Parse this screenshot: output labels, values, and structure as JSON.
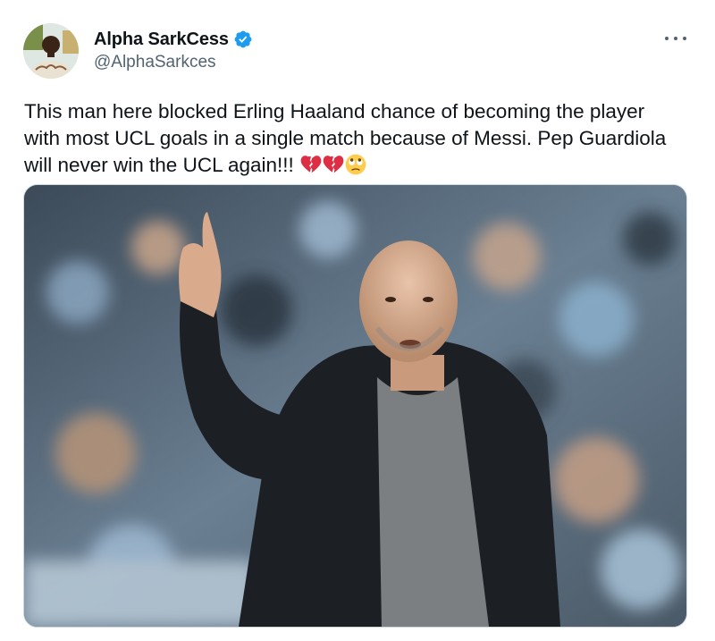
{
  "author": {
    "display_name": "Alpha SarkCess",
    "handle": "@AlphaSarkces",
    "verified": true
  },
  "tweet": {
    "text": "This man here blocked Erling Haaland chance of becoming the player with most UCL goals in a single match because of Messi. Pep Guardiola will never win the UCL again!!!",
    "emojis": [
      "broken-heart",
      "broken-heart",
      "face-with-rolling-eyes"
    ]
  },
  "colors": {
    "text": "#0f1419",
    "secondary": "#536471",
    "verified": "#1d9bf0",
    "border": "#cfd9de"
  },
  "icons": {
    "verified": "verified-badge-icon",
    "more": "more-options-icon"
  }
}
